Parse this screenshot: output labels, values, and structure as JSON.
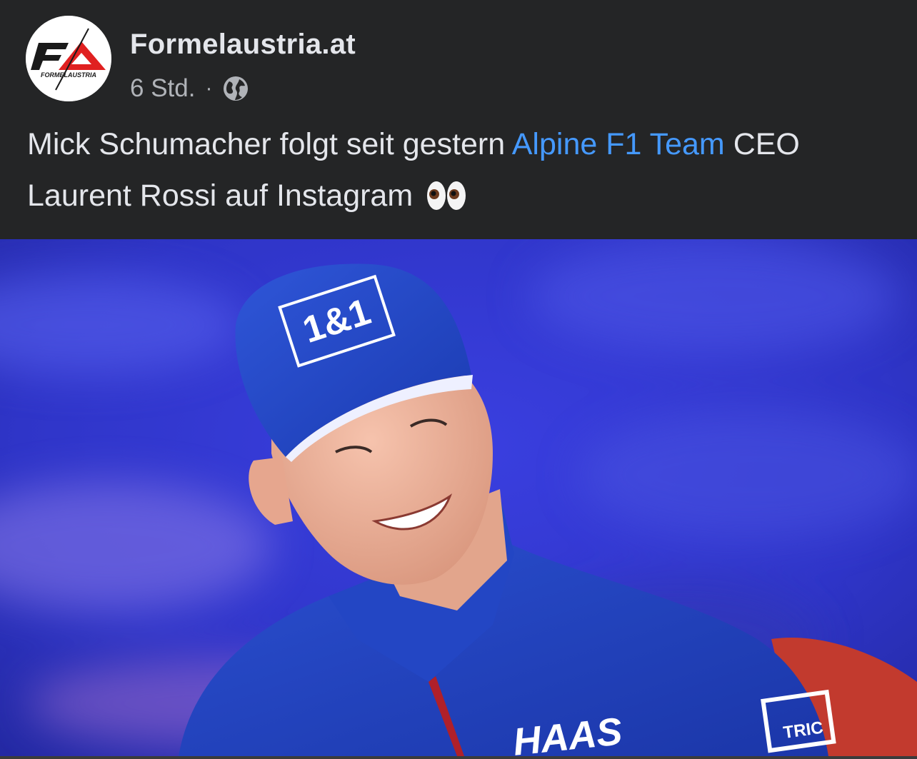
{
  "post": {
    "page_name": "Formelaustria.at",
    "avatar_logo_text": "FORMELAUSTRIA",
    "timestamp": "6 Std.",
    "separator": "·",
    "privacy_icon": "globe-icon",
    "text_part1": "Mick Schumacher folgt seit gestern",
    "link_text": "Alpine F1 Team",
    "text_part2": "CEO Laurent Rossi auf Instagram",
    "emoji": "eyes-emoji",
    "photo": {
      "cap_logo_text": "1&1",
      "jacket_logo_text": "HAAS",
      "sponsor_patch_text": "TRIC"
    }
  },
  "colors": {
    "background": "#242526",
    "primary_text": "#e4e6eb",
    "secondary_text": "#b0b3b8",
    "link": "#4599ff",
    "photo_backdrop": "#3b3fd0"
  }
}
